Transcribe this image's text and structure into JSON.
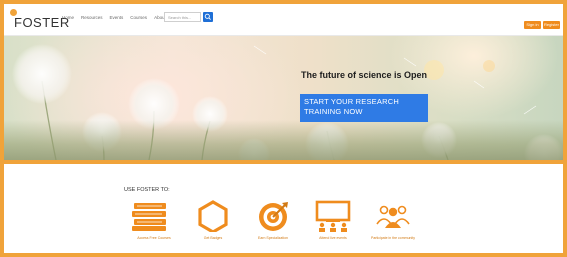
{
  "header": {
    "logo_text": "FOSTER",
    "nav": [
      "Home",
      "Resources",
      "Events",
      "Courses",
      "About"
    ],
    "search": {
      "placeholder": "Search this..."
    },
    "signin_label": "Sign in",
    "register_label": "Register"
  },
  "hero": {
    "title": "The future of science is Open",
    "cta_line1": "START YOUR RESEARCH",
    "cta_line2": "TRAINING NOW"
  },
  "use": {
    "label": "USE FOSTER TO:",
    "features": [
      {
        "label": "Access Free Courses",
        "icon": "books-icon"
      },
      {
        "label": "Get Badges",
        "icon": "hexagon-badge-icon"
      },
      {
        "label": "Earn Specialization",
        "icon": "target-icon"
      },
      {
        "label": "Attend live events",
        "icon": "presentation-icon"
      },
      {
        "label": "Participate in the community",
        "icon": "community-icon"
      }
    ]
  },
  "colors": {
    "accent": "#f0a33a",
    "orange_dark": "#ef8c1e",
    "blue": "#2f7be5"
  }
}
